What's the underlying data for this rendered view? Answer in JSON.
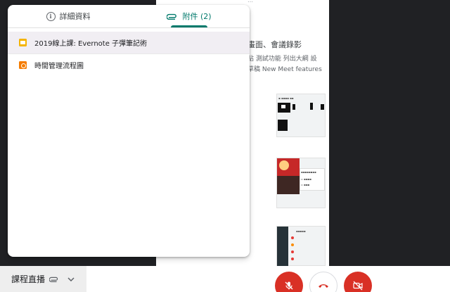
{
  "background_doc": {
    "lines": [
      "畫面、會議錄影",
      "貼 測試功能 列出大綱 設",
      "草稿 New Meet features"
    ]
  },
  "panel": {
    "tabs": [
      {
        "label": "詳細資料",
        "icon": "info-icon",
        "active": false
      },
      {
        "label": "附件 (2)",
        "icon": "paperclip-icon",
        "active": true
      }
    ],
    "attachments": [
      {
        "label": "2019線上課: Evernote 子彈筆記術",
        "icon": "google-slides-icon",
        "color": "#f4b400",
        "selected": true
      },
      {
        "label": "時間管理流程圖",
        "icon": "google-drawings-icon",
        "color": "#f57c00",
        "selected": false
      }
    ]
  },
  "bottom_bar": {
    "meeting_title": "課程直播",
    "controls": [
      {
        "name": "mic-off",
        "icon": "mic-off-icon",
        "color": "#d93025"
      },
      {
        "name": "hang-up",
        "icon": "phone-hangup-icon",
        "color": "#d93025"
      },
      {
        "name": "camera-off",
        "icon": "camera-off-icon",
        "color": "#d93025"
      }
    ]
  },
  "colors": {
    "accent": "#00796b",
    "danger": "#d93025",
    "dark_bg": "#202124"
  }
}
